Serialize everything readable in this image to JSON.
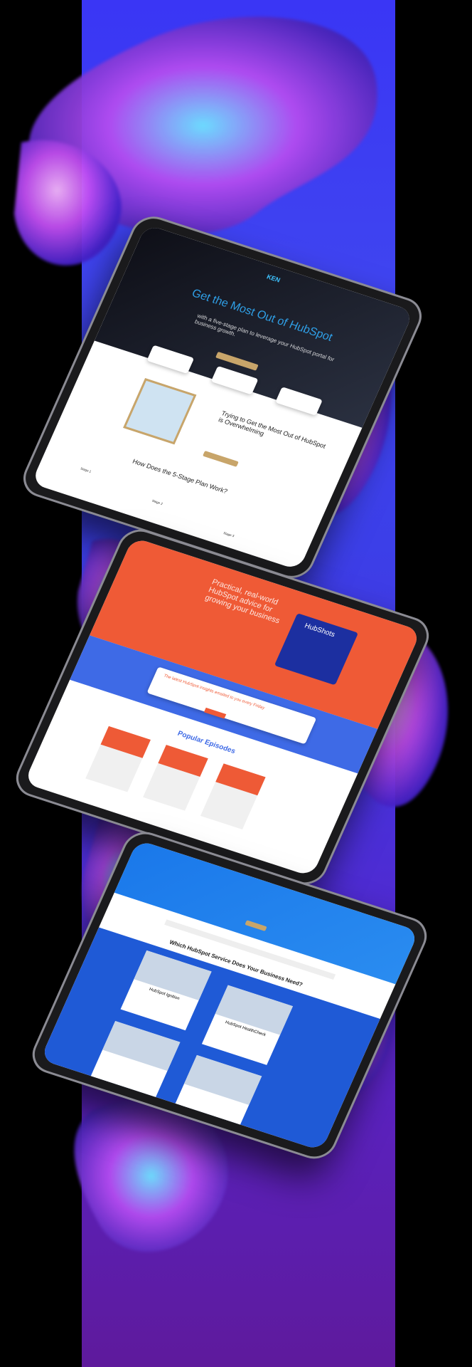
{
  "tablet1": {
    "logo": "KEN",
    "hero_title": "Get the Most Out of HubSpot",
    "hero_subtitle": "with a five-stage plan to leverage your HubSpot portal for business growth.",
    "headline": "Trying to Get the Most Out of HubSpot is Overwhelming",
    "section_title": "How Does the 5-Stage Plan Work?",
    "stage1": "Stage 1",
    "stage2": "Stage 2",
    "stage3": "Stage 3"
  },
  "tablet2": {
    "hero_text": "Practical, real-world HubSpot advice for growing your business",
    "podcast_title": "HubShots",
    "signup_title": "The latest HubSpot insights emailed to you every Friday",
    "section_title": "Popular Episodes"
  },
  "tablet3": {
    "section_title": "Which HubSpot Service Does Your Business Need?",
    "service1": "HubSpot Ignition",
    "service2": "HubSpot HealthCheck"
  },
  "colors": {
    "band": "#3a36f5",
    "orange": "#ef5a36",
    "blue": "#3e6ae6",
    "gold": "#c8a56a"
  }
}
